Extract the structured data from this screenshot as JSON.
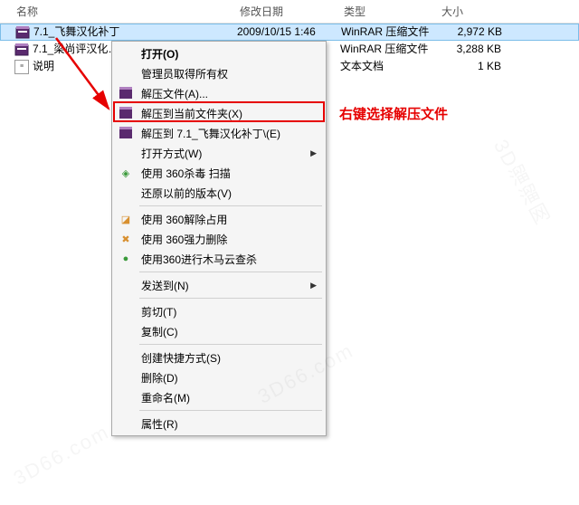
{
  "columns": {
    "name": "名称",
    "date": "修改日期",
    "type": "类型",
    "size": "大小"
  },
  "files": [
    {
      "name": "7.1_飞舞汉化补丁",
      "date": "2009/10/15 1:46",
      "type": "WinRAR 压缩文件",
      "size": "2,972 KB",
      "icon": "rar"
    },
    {
      "name": "7.1_梁尚评汉化…",
      "date": "",
      "type": "WinRAR 压缩文件",
      "size": "3,288 KB",
      "icon": "rar"
    },
    {
      "name": "说明",
      "date": "",
      "type": "文本文档",
      "size": "1 KB",
      "icon": "txt"
    }
  ],
  "menu": {
    "open": "打开(O)",
    "adminOwn": "管理员取得所有权",
    "extractFiles": "解压文件(A)...",
    "extractHere": "解压到当前文件夹(X)",
    "extractTo": "解压到 7.1_飞舞汉化补丁\\(E)",
    "openWith": "打开方式(W)",
    "scan360": "使用 360杀毒 扫描",
    "restorePrev": "还原以前的版本(V)",
    "release360": "使用 360解除占用",
    "forceDel360": "使用 360强力删除",
    "trojan360": "使用360进行木马云查杀",
    "sendTo": "发送到(N)",
    "cut": "剪切(T)",
    "copy": "复制(C)",
    "shortcut": "创建快捷方式(S)",
    "del": "删除(D)",
    "rename": "重命名(M)",
    "props": "属性(R)"
  },
  "annotation": "右键选择解压文件"
}
